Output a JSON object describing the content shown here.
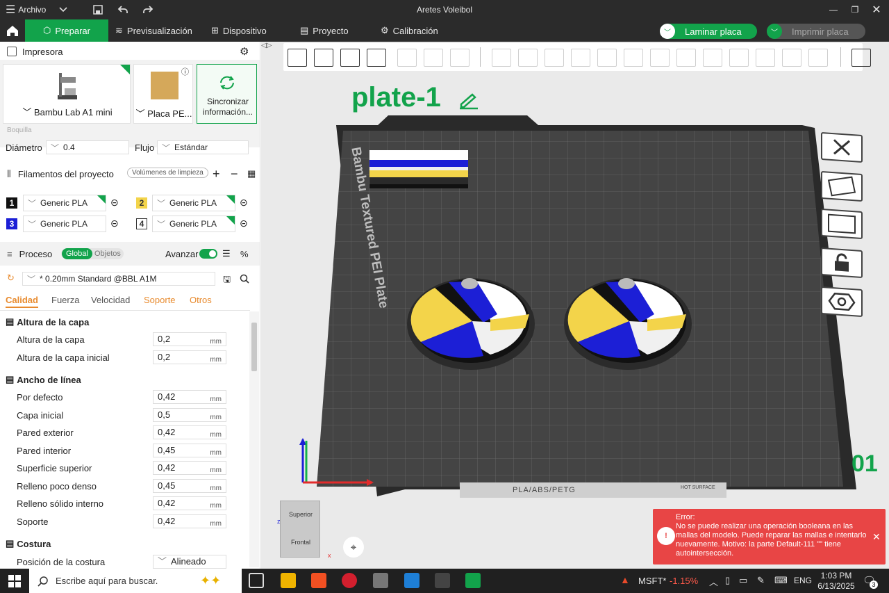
{
  "window": {
    "menu_label": "Archivo",
    "title": "Aretes Voleibol"
  },
  "tabs": [
    {
      "label": "Preparar"
    },
    {
      "label": "Previsualización"
    },
    {
      "label": "Dispositivo"
    },
    {
      "label": "Proyecto"
    },
    {
      "label": "Calibración"
    }
  ],
  "actions": {
    "slice_label": "Laminar placa",
    "print_label": "Imprimir placa"
  },
  "printer": {
    "section_title": "Impresora",
    "model": "Bambu Lab A1 mini",
    "plate": "Placa PE...",
    "sync_label": "Sincronizar información...",
    "nozzle_label": "Boquilla",
    "diameter_label": "Diámetro",
    "diameter_value": "0.4",
    "flow_label": "Flujo",
    "flow_value": "Estándar"
  },
  "filaments": {
    "section_title": "Filamentos del proyecto",
    "purge_button": "Volúmenes de limpieza",
    "items": [
      {
        "num": "1",
        "name": "Generic PLA",
        "color": "#111111"
      },
      {
        "num": "2",
        "name": "Generic PLA",
        "color": "#f3d44a"
      },
      {
        "num": "3",
        "name": "Generic PLA",
        "color": "#1c1fd6"
      },
      {
        "num": "4",
        "name": "Generic PLA",
        "color": "#ffffff"
      }
    ]
  },
  "process": {
    "section_title": "Proceso",
    "global_label": "Global",
    "objects_label": "Objetos",
    "advanced_label": "Avanzar",
    "preset": "* 0.20mm Standard @BBL A1M",
    "tabs": [
      "Calidad",
      "Fuerza",
      "Velocidad",
      "Soporte",
      "Otros"
    ],
    "groups": [
      {
        "title": "Altura de la capa",
        "rows": [
          {
            "label": "Altura de la capa",
            "value": "0,2",
            "unit": "mm"
          },
          {
            "label": "Altura de la capa inicial",
            "value": "0,2",
            "unit": "mm"
          }
        ]
      },
      {
        "title": "Ancho de línea",
        "rows": [
          {
            "label": "Por defecto",
            "value": "0,42",
            "unit": "mm"
          },
          {
            "label": "Capa inicial",
            "value": "0,5",
            "unit": "mm"
          },
          {
            "label": "Pared exterior",
            "value": "0,42",
            "unit": "mm"
          },
          {
            "label": "Pared interior",
            "value": "0,45",
            "unit": "mm"
          },
          {
            "label": "Superficie superior",
            "value": "0,42",
            "unit": "mm"
          },
          {
            "label": "Relleno poco denso",
            "value": "0,45",
            "unit": "mm"
          },
          {
            "label": "Relleno sólido interno",
            "value": "0,42",
            "unit": "mm"
          },
          {
            "label": "Soporte",
            "value": "0,42",
            "unit": "mm"
          }
        ]
      },
      {
        "title": "Costura",
        "rows": [
          {
            "label": "Posición de la costura",
            "value": "Alineado",
            "unit": ""
          }
        ]
      }
    ]
  },
  "viewport": {
    "plate_name": "plate-1",
    "plate_label": "Bambu Textured PEI Plate",
    "plate_footer": "PLA/ABS/PETG",
    "hot_surface": "HOT SURFACE",
    "plate_number": "01",
    "cube_top": "Superior",
    "cube_front": "Frontal",
    "axis_z": "z",
    "axis_x": "x"
  },
  "error": {
    "title": "Error:",
    "message": "No se puede realizar una operación booleana en las mallas del modelo. Puede reparar las mallas e intentarlo nuevamente. Motivo: la parte Default-111 \"\" tiene autointersección."
  },
  "taskbar": {
    "search_placeholder": "Escribe aquí para buscar.",
    "stock_symbol": "MSFT*",
    "stock_change": "-1.15%",
    "language": "ENG",
    "time": "1:03 PM",
    "date": "6/13/2025",
    "notifications": "3"
  }
}
